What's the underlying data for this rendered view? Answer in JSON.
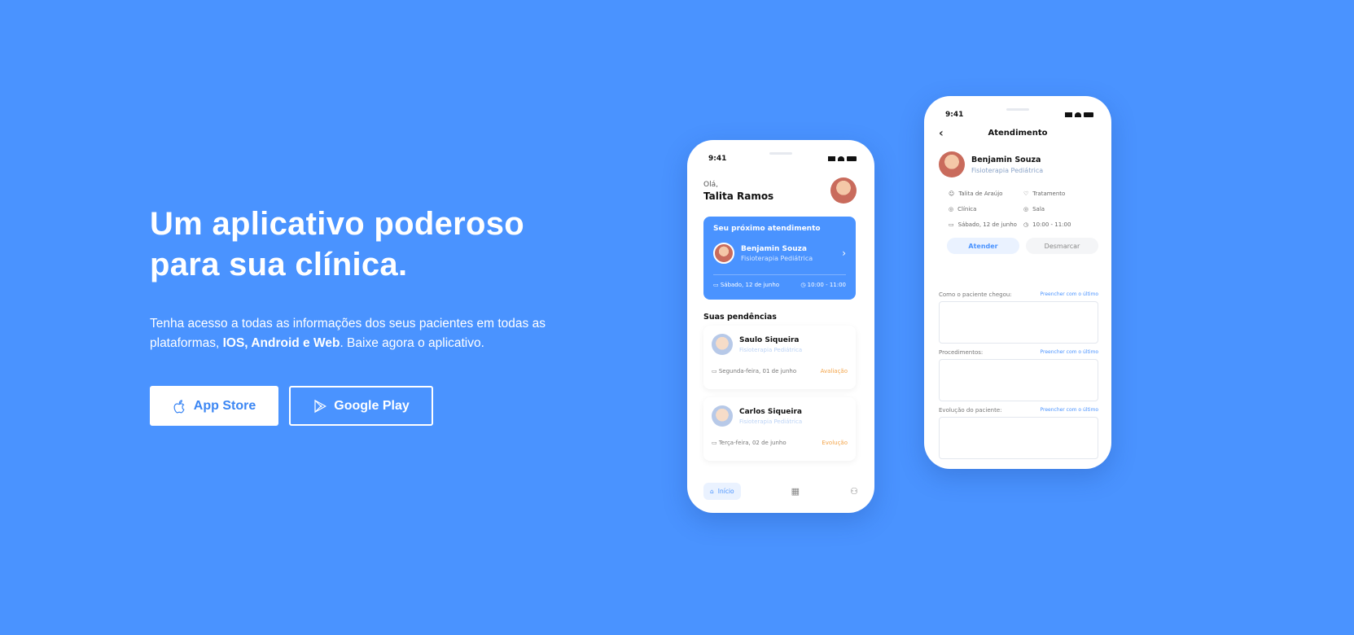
{
  "hero": {
    "title_line1": "Um aplicativo poderoso",
    "title_line2": "para sua clínica.",
    "desc_part1": "Tenha acesso a todas as informações dos seus pacientes em todas as plataformas, ",
    "desc_bold": "IOS, Android e Web",
    "desc_part2": ". Baixe agora o aplicativo.",
    "btn_appstore": "App Store",
    "btn_googleplay": "Google Play"
  },
  "phone1": {
    "time": "9:41",
    "greeting": "Olá,",
    "user_name": "Talita Ramos",
    "next_title": "Seu próximo atendimento",
    "next_patient": "Benjamin Souza",
    "next_specialty": "Fisioterapia Pediátrica",
    "next_date": "Sábado, 12 de junho",
    "next_time": "10:00 - 11:00",
    "pending_title": "Suas pendências",
    "pending": [
      {
        "name": "Saulo Siqueira",
        "specialty": "Fisioterapia Pediátrica",
        "date": "Segunda-feira, 01 de junho",
        "tag": "Avaliação"
      },
      {
        "name": "Carlos Siqueira",
        "specialty": "Fisioterapia Pediátrica",
        "date": "Terça-feira, 02 de junho",
        "tag": "Evolução"
      }
    ],
    "tab_home": "Início"
  },
  "phone2": {
    "time": "9:41",
    "header": "Atendimento",
    "patient": "Benjamin Souza",
    "specialty": "Fisioterapia Pediátrica",
    "info": {
      "professional": "Talita de Araújo",
      "treatment": "Tratamento",
      "clinic": "Clínica",
      "room": "Sala",
      "date": "Sábado, 12 de junho",
      "time": "10:00 - 11:00"
    },
    "btn_attend": "Atender",
    "btn_cancel": "Desmarcar",
    "fields": [
      {
        "label": "Como o paciente chegou:",
        "fill": "Preencher com o último"
      },
      {
        "label": "Procedimentos:",
        "fill": "Preencher com o último"
      },
      {
        "label": "Evolução do paciente:",
        "fill": "Preencher com o último"
      }
    ]
  },
  "colors": {
    "background": "#4a93ff",
    "accent": "#4a93ff",
    "tag": "#f3a44a"
  }
}
